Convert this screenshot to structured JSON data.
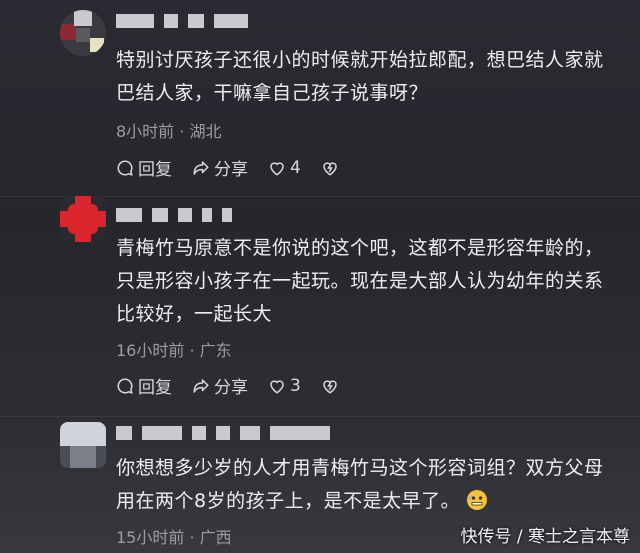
{
  "comments": [
    {
      "text_lines": [
        "特别讨厌孩子还很小的时候就开始拉郎配，想巴结人家就",
        "巴结人家，干嘛拿自己孩子说事呀？"
      ],
      "meta": "8小时前 · 湖北",
      "reply_label": "回复",
      "share_label": "分享",
      "like_count": "4",
      "avatar_colors": [
        "#8a2a37",
        "#c9c9cf",
        "#5b5b5b",
        "#e8e2c0"
      ]
    },
    {
      "text_lines": [
        "青梅竹马原意不是你说的这个吧，这都不是形容年龄的，",
        "只是形容小孩子在一起玩。现在是大部人认为幼年的关系",
        "比较好，一起长大"
      ],
      "meta": "16小时前 · 广东",
      "reply_label": "回复",
      "share_label": "分享",
      "like_count": "3",
      "avatar_colors": [
        "#d9252b"
      ]
    },
    {
      "text_lines": [
        "你想想多少岁的人才用青梅竹马这个形容词组？双方父母",
        "用在两个8岁的孩子上，是不是太早了。"
      ],
      "meta": "15小时前 · 广西",
      "avatar_colors": [
        "#cfd3dc"
      ]
    }
  ],
  "watermark": "快传号 / 寒士之言本尊",
  "icons": [
    "reply-icon",
    "share-icon",
    "heart-icon",
    "dislike-icon",
    "emoji-icon"
  ]
}
